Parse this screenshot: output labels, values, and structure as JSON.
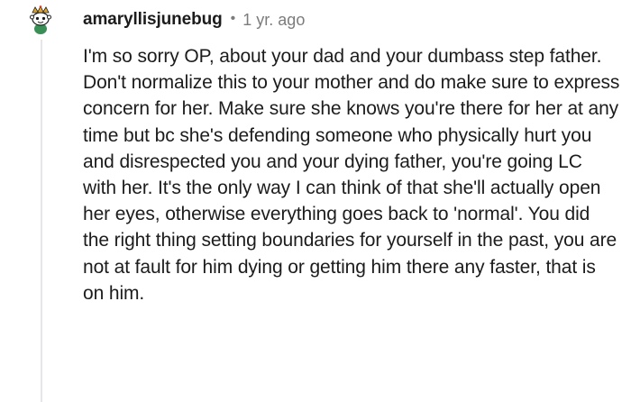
{
  "comment": {
    "author": "amaryllisjunebug",
    "separator": "•",
    "age": "1 yr. ago",
    "body": "I'm so sorry OP, about your dad and your dumbass step father. Don't normalize this to your mother and do make sure to express concern for her. Make sure she knows you're there for her at any time but bc she's defending someone who physically hurt you and disrespected you and your dying father, you're going LC with her. It's the only way I can think of that she'll actually open her eyes, otherwise everything goes back to 'normal'. You did the right thing setting boundaries for yourself in the past, you are not at fault for him dying or getting him there any faster, that is on him."
  },
  "icons": {
    "avatar": "snoo-avatar-icon"
  },
  "colors": {
    "text": "#1c1c1c",
    "meta": "#7c7c7c",
    "thread_line": "#e4e6e8"
  }
}
